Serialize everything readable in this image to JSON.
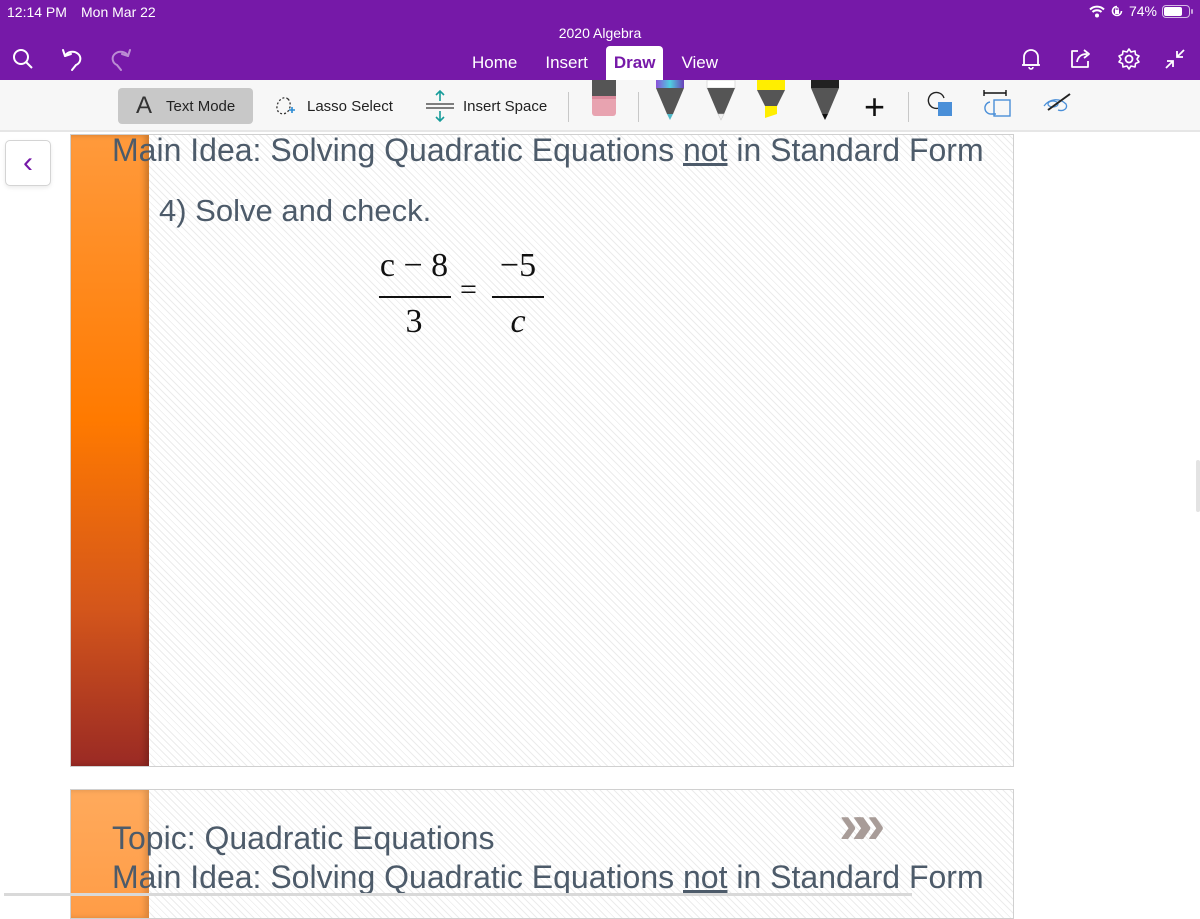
{
  "status": {
    "time": "12:14 PM",
    "date": "Mon Mar 22",
    "battery_percent": "74%",
    "battery_level": 0.74,
    "icons": [
      "wifi-icon",
      "orientation-lock-icon",
      "battery-icon"
    ]
  },
  "ribbon": {
    "notebook_title": "2020 Algebra",
    "tabs": [
      {
        "label": "Home",
        "active": false
      },
      {
        "label": "Insert",
        "active": false
      },
      {
        "label": "Draw",
        "active": true
      },
      {
        "label": "View",
        "active": false
      }
    ],
    "left_icons": [
      "search-icon",
      "undo-icon",
      "redo-icon"
    ],
    "right_icons": [
      "bell-icon",
      "share-icon",
      "gear-icon",
      "collapse-icon"
    ]
  },
  "toolbar": {
    "text_mode": "Text Mode",
    "text_mode_glyph": "A",
    "lasso_select": "Lasso Select",
    "insert_space": "Insert Space",
    "tools": [
      "eraser",
      "galaxy-pen",
      "white-pen",
      "yellow-highlighter",
      "black-pen",
      "add-pen",
      "shapes",
      "ink-to-shape",
      "ink-replay"
    ],
    "add_glyph": "+"
  },
  "colors": {
    "accent": "#7619a8",
    "slide_text": "#4d5b6a",
    "bar_orange": "#ff7a00",
    "bar_red": "#a02a22"
  },
  "page": {
    "back_glyph": "‹",
    "slide1": {
      "main_idea_prefix": "Main Idea:  Solving Quadratic Equations ",
      "main_idea_underlined": "not",
      "main_idea_suffix": " in Standard Form",
      "problem": "4)  Solve and check.",
      "equation": {
        "left_numerator": "c − 8",
        "left_denominator": "3",
        "equals": "=",
        "right_numerator": "−5",
        "right_denominator": "c"
      }
    },
    "slide2": {
      "topic": "Topic:  Quadratic Equations",
      "main_idea_prefix": "Main Idea:  Solving Quadratic Equations ",
      "main_idea_underlined": "not",
      "main_idea_suffix": " in Standard Form",
      "chevron_glyph": "»»"
    }
  }
}
